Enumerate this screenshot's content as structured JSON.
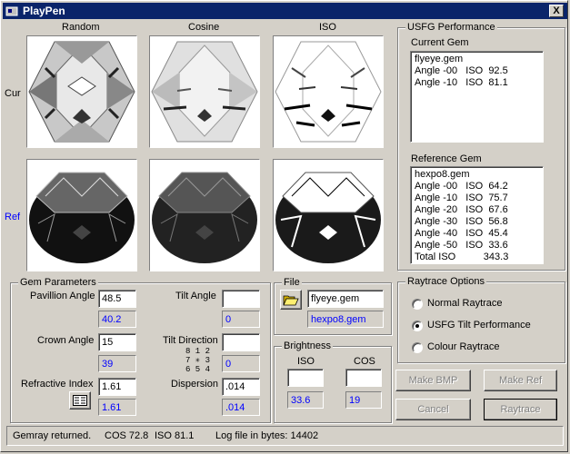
{
  "window": {
    "title": "PlayPen",
    "close_glyph": "X"
  },
  "columns": [
    "Random",
    "Cosine",
    "ISO"
  ],
  "rows": {
    "current": "Cur",
    "reference": "Ref"
  },
  "performance": {
    "title": "USFG Performance",
    "current_label": "Current Gem",
    "current_lines": [
      "flyeye.gem",
      "Angle -00   ISO  92.5",
      "Angle -10   ISO  81.1"
    ],
    "reference_label": "Reference Gem",
    "reference_lines": [
      "hexpo8.gem",
      "Angle -00   ISO  64.2",
      "Angle -10   ISO  75.7",
      "Angle -20   ISO  67.6",
      "Angle -30   ISO  56.8",
      "Angle -40   ISO  45.4",
      "Angle -50   ISO  33.6",
      "Total ISO          343.3"
    ]
  },
  "gem_params": {
    "title": "Gem Parameters",
    "pavillion_label": "Pavillion Angle",
    "pavillion_value": "48.5",
    "pavillion_ref": "40.2",
    "crown_label": "Crown Angle",
    "crown_value": "15",
    "crown_ref": "39",
    "ri_label": "Refractive Index",
    "ri_value": "1.61",
    "ri_ref": "1.61",
    "tilt_angle_label": "Tilt Angle",
    "tilt_angle_value": "",
    "tilt_angle_ref": "0",
    "tilt_dir_label": "Tilt Direction",
    "tilt_dir_value": "",
    "tilt_dir_ref": "0",
    "compass_row1": "8 1 2",
    "compass_row2": "7 ✳ 3",
    "compass_row3": "6 5 4",
    "dispersion_label": "Dispersion",
    "dispersion_value": ".014",
    "dispersion_ref": ".014"
  },
  "file": {
    "title": "File",
    "current_file": "flyeye.gem",
    "reference_file": "hexpo8.gem"
  },
  "brightness": {
    "title": "Brightness",
    "iso_label": "ISO",
    "cos_label": "COS",
    "iso_value": "",
    "cos_value": "",
    "iso_ref": "33.6",
    "cos_ref": "19"
  },
  "raytrace": {
    "title": "Raytrace Options",
    "options": [
      "Normal Raytrace",
      "USFG Tilt Performance",
      "Colour Raytrace"
    ],
    "selected": "USFG Tilt Performance"
  },
  "buttons": {
    "make_bmp": "Make BMP",
    "make_ref": "Make Ref",
    "cancel": "Cancel",
    "raytrace": "Raytrace"
  },
  "status": {
    "gemray": "Gemray returned.",
    "cos": "COS  72.8",
    "iso": "ISO  81.1",
    "log": "Log file in bytes:  14402"
  }
}
